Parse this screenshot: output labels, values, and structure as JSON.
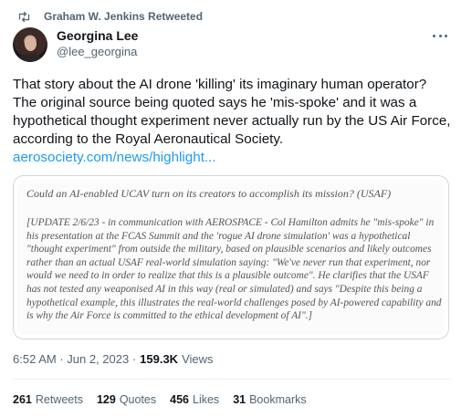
{
  "retweet_header": {
    "icon": "retweet-icon",
    "text": "Graham W. Jenkins Retweeted"
  },
  "author": {
    "name": "Georgina Lee",
    "handle": "@lee_georgina",
    "more_icon": "more-icon"
  },
  "tweet": {
    "text": "That story about the AI drone 'killing' its imaginary human operator? The original source being quoted says he 'mis-spoke' and it was a hypothetical thought experiment never actually run by the US Air Force, according to the Royal Aeronautical Society.",
    "link": "aerosociety.com/news/highlight..."
  },
  "card": {
    "question": "Could an AI-enabled UCAV turn on its creators to accomplish its mission? (USAF)",
    "body": "[UPDATE 2/6/23 - in communication with AEROSPACE - Col Hamilton admits he \"mis-spoke\" in his presentation at the FCAS Summit and the 'rogue AI drone simulation' was a hypothetical \"thought experiment\" from outside the military, based on plausible scenarios and likely outcomes rather than an actual USAF real-world simulation saying: \"We've never run that experiment, nor would we need to in order to realize that this is a plausible outcome\". He clarifies that the USAF has not tested any weaponised AI in this way (real or simulated) and says \"Despite this being a hypothetical example, this illustrates the real-world challenges posed by AI-powered capability and is why the Air Force is committed to the ethical development of AI\".]"
  },
  "meta": {
    "time": "6:52 AM · Jun 2, 2023 ·",
    "views_count": "159.3K",
    "views_label": "Views"
  },
  "stats": [
    {
      "count": "261",
      "label": "Retweets"
    },
    {
      "count": "129",
      "label": "Quotes"
    },
    {
      "count": "456",
      "label": "Likes"
    },
    {
      "count": "31",
      "label": "Bookmarks"
    }
  ],
  "colors": {
    "link": "#1d9bf0",
    "secondary_text": "#536471",
    "border": "#cfd9de"
  }
}
